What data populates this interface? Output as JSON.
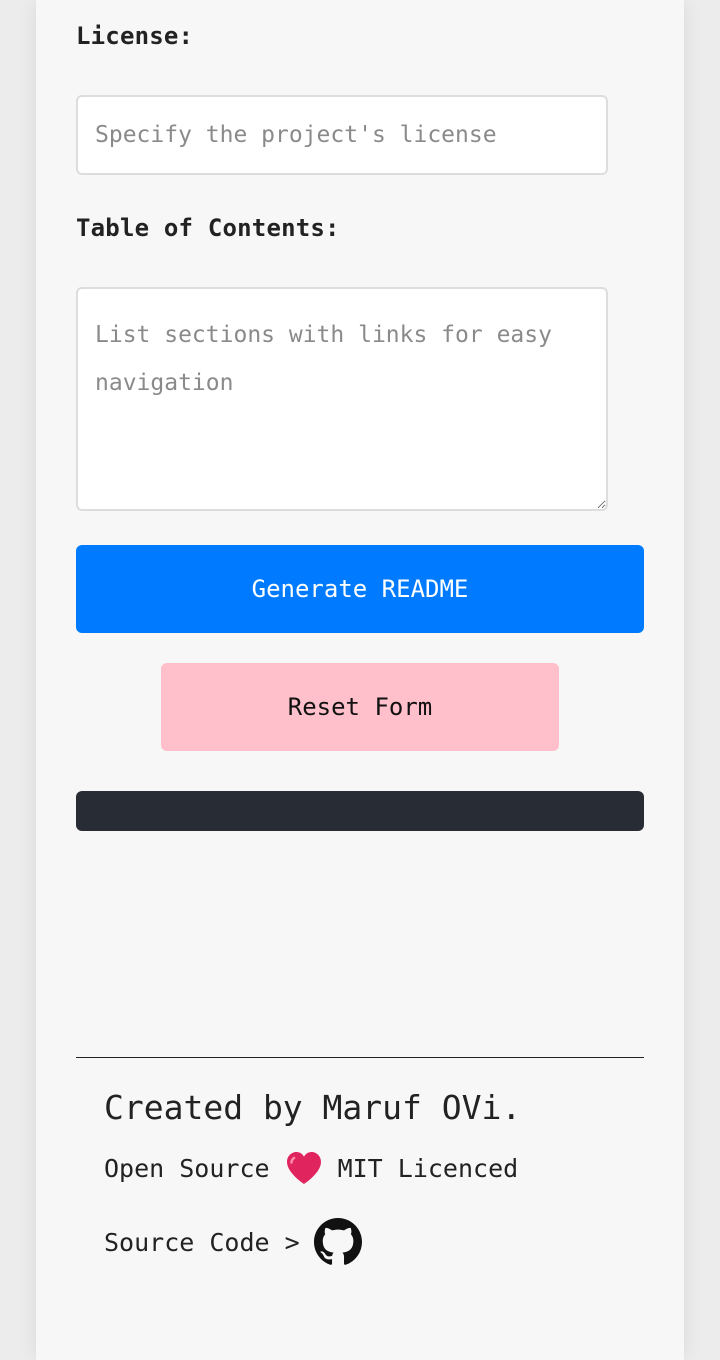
{
  "form": {
    "license": {
      "label": "License:",
      "placeholder": "Specify the project's license",
      "value": ""
    },
    "toc": {
      "label": "Table of Contents:",
      "placeholder": "List sections with links for easy navigation",
      "value": ""
    },
    "generate_label": "Generate README",
    "reset_label": "Reset Form"
  },
  "footer": {
    "created_by": "Created by Maruf OVi.",
    "open_source": "Open Source",
    "licence": "MIT Licenced",
    "source_code": "Source Code >",
    "heart_icon": "heart-icon",
    "github_icon": "github-icon"
  },
  "colors": {
    "primary": "#007bff",
    "reset": "#ffc0cb",
    "output_bg": "#282c34",
    "heart": "#e0245e"
  }
}
